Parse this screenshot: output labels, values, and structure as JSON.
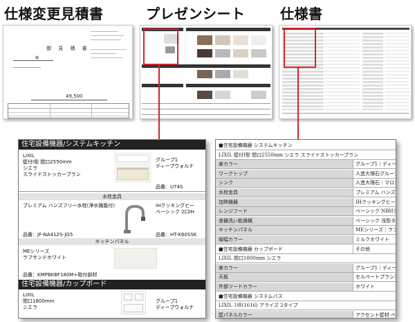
{
  "titles": {
    "quote": "仕様変更見積書",
    "presentation": "プレゼンシート",
    "spec": "仕様書"
  },
  "quote_doc": {
    "title": "御 見 積 書",
    "recipient": "様",
    "amount": "49,500"
  },
  "detail": {
    "kitchen_section": "住宅設備機器/システムキッチン",
    "kitchen_name": [
      "LIXIL",
      "壁付I型 間口2550mm",
      "シエラ",
      "スライドストッカープラン"
    ],
    "group_label": [
      "グループ1",
      "ディープウォルナ"
    ],
    "kitchen_code": "品番：U74S",
    "faucet_sub": "水栓金具",
    "faucet_name": "プレミアム ハンズフリー水栓(浄水機能付)",
    "ih_label": [
      "IHクッキングヒー",
      "ベーシック 2口IH"
    ],
    "faucet_code": "品番：JF-NA412S-JG5",
    "ih_code": "品番：HT-K60SSK",
    "panel_sub": "キッチンパネル",
    "panel_name": [
      "MEシリーズ",
      "ラフサンドホワイト"
    ],
    "panel_code": "品番：KMPBKBF180M+取付部材",
    "cupboard_section": "住宅設備機器/カップボード",
    "cupboard_name": [
      "LIXIL",
      "間口1800mm",
      "シエラ"
    ],
    "cupboard_group": [
      "グループ1",
      "ディープウォルナ"
    ]
  },
  "spec": {
    "rows": [
      {
        "type": "full",
        "key": "■住宅設備機器 システムキッチン",
        "val": ""
      },
      {
        "type": "full",
        "key": "LIXIL 壁付I型 間口2550mm シエラ スライドストッカープラン",
        "val": ""
      },
      {
        "type": "gray",
        "key": "扉カラー",
        "val": "グループ1｜ディープウォ"
      },
      {
        "type": "gray",
        "key": "ワークトップ",
        "val": "人造大理石グループ1｜"
      },
      {
        "type": "gray",
        "key": "シンク",
        "val": "人造大理石｜マロンベー"
      },
      {
        "type": "gray",
        "key": "水栓金具",
        "val": "プレミアム ハンズフリー"
      },
      {
        "type": "gray",
        "key": "加熱機器",
        "val": "IHクッキングヒーター｜"
      },
      {
        "type": "gray",
        "key": "レンジフード",
        "val": "ベーシック NBHシリーズ"
      },
      {
        "type": "gray",
        "key": "食器洗い乾燥機",
        "val": "ベーシック 浅型タイプ"
      },
      {
        "type": "gray",
        "key": "キッチンパネル",
        "val": "MEシリーズ｜ラフサンド"
      },
      {
        "type": "gray",
        "key": "縦幅カラー",
        "val": "ミルクホワイト"
      },
      {
        "type": "full",
        "key": "■住宅設備機器 カップボード",
        "val": "その他"
      },
      {
        "type": "full",
        "key": "LIXIL 間口1800mm シエラ",
        "val": ""
      },
      {
        "type": "gray",
        "key": "扉カラー",
        "val": "グループ1｜ディープウォ"
      },
      {
        "type": "gray",
        "key": "天板",
        "val": "セルペートプラン1段タイプ"
      },
      {
        "type": "gray",
        "key": "外部ツードカラー",
        "val": "ホワイト"
      },
      {
        "type": "full",
        "key": "■住宅設備機器 システムバス",
        "val": ""
      },
      {
        "type": "full",
        "key": "LIXIL 1坪(1616) アライズ 2タイプ",
        "val": ""
      },
      {
        "type": "gray",
        "key": "壁パネルカラー",
        "val": "アクセント壁材 ベースパ"
      }
    ]
  },
  "colors": {
    "accent": "#d3232c",
    "header_dark": "#222222",
    "row_gray": "#d8d8d8"
  }
}
